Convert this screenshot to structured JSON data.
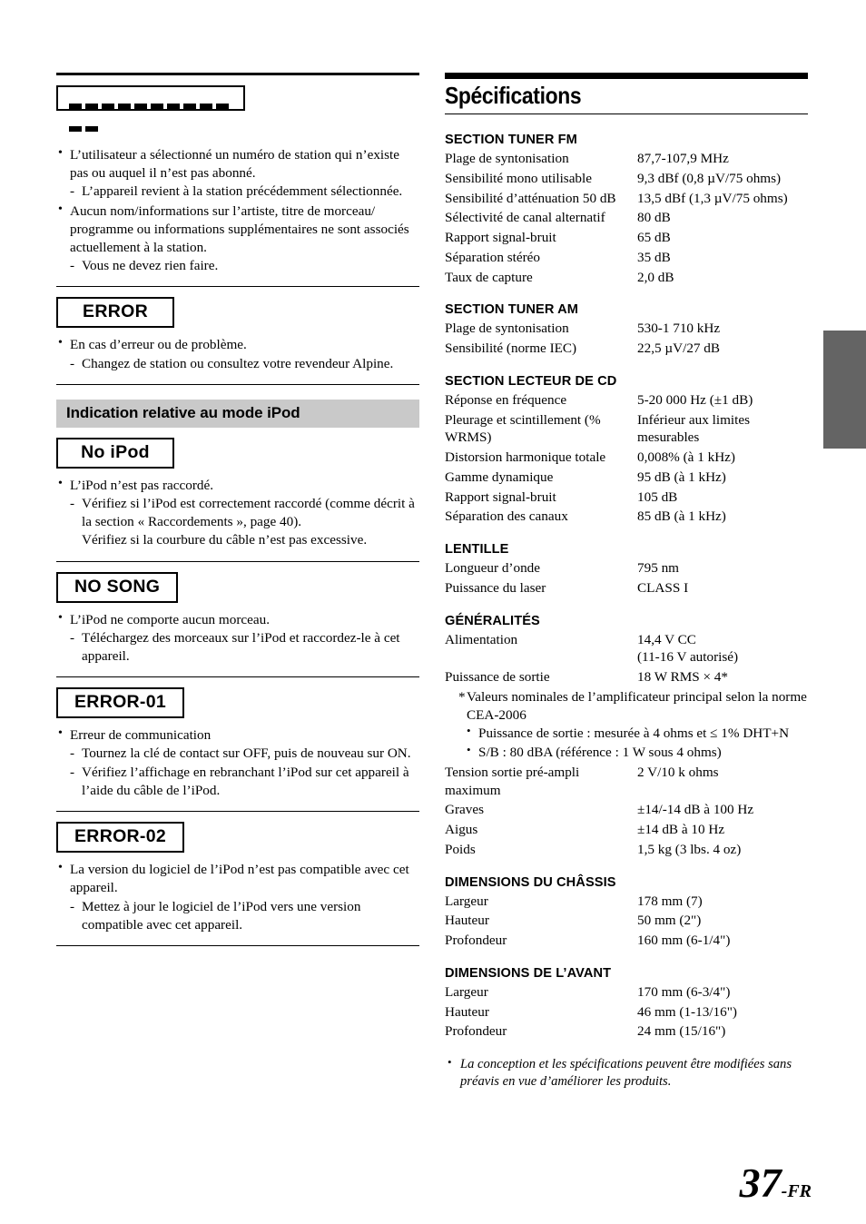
{
  "page": {
    "number": "37",
    "suffix": "-FR"
  },
  "left_column": {
    "blank_display": {
      "icon": "dashes-display",
      "dash_count": 12
    },
    "blank_display_items": [
      {
        "bullet": "L’utilisateur a sélectionné un numéro de station qui n’existe pas ou auquel il n’est pas abonné.",
        "sub": "L’appareil revient à la station précédemment sélectionnée."
      },
      {
        "bullet": "Aucun nom/informations sur l’artiste, titre de morceau/ programme ou informations supplémentaires ne sont associés actuellement à la station.",
        "sub": "Vous ne devez rien faire."
      }
    ],
    "error_box": {
      "label": "ERROR",
      "items": [
        {
          "bullet": "En cas d’erreur ou de problème.",
          "sub": "Changez de station ou consultez votre revendeur Alpine."
        }
      ]
    },
    "ipod_section": {
      "heading": "Indication relative au mode iPod"
    },
    "no_ipod_box": {
      "label": "No iPod",
      "items": [
        {
          "bullet": "L’iPod n’est pas raccordé.",
          "sub": "Vérifiez si l’iPod est correctement raccordé (comme décrit à la section « Raccordements », page 40).",
          "sub_cont": "Vérifiez si la courbure du câble n’est pas excessive."
        }
      ]
    },
    "no_song_box": {
      "label": "NO SONG",
      "items": [
        {
          "bullet": "L’iPod ne comporte aucun morceau.",
          "sub": "Téléchargez des morceaux sur l’iPod et raccordez-le à cet appareil."
        }
      ]
    },
    "error_01_box": {
      "label": "ERROR-01",
      "items": [
        {
          "bullet": "Erreur de communication",
          "sub": "Tournez la clé de contact sur OFF, puis de nouveau sur ON.",
          "sub2": "Vérifiez l’affichage en rebranchant l’iPod sur cet appareil à l’aide du câble de l’iPod."
        }
      ]
    },
    "error_02_box": {
      "label": "ERROR-02",
      "items": [
        {
          "bullet": "La version du logiciel de l’iPod n’est pas compatible avec cet appareil.",
          "sub": "Mettez à jour le logiciel de l’iPod vers une version compatible avec cet appareil."
        }
      ]
    }
  },
  "right_column": {
    "title": "Spécifications",
    "sections": [
      {
        "heading": "SECTION TUNER FM",
        "rows": [
          {
            "label": "Plage de syntonisation",
            "value": "87,7-107,9 MHz"
          },
          {
            "label": "Sensibilité mono utilisable",
            "value": "9,3 dBf (0,8 µV/75 ohms)"
          },
          {
            "label": "Sensibilité d’atténuation 50 dB",
            "value": "13,5 dBf (1,3 µV/75 ohms)"
          },
          {
            "label": "Sélectivité de canal alternatif",
            "value": "80 dB"
          },
          {
            "label": "Rapport signal-bruit",
            "value": "65 dB"
          },
          {
            "label": "Séparation stéréo",
            "value": "35 dB"
          },
          {
            "label": "Taux de capture",
            "value": "2,0 dB"
          }
        ]
      },
      {
        "heading": "SECTION TUNER AM",
        "rows": [
          {
            "label": "Plage de syntonisation",
            "value": "530-1 710 kHz"
          },
          {
            "label": "Sensibilité (norme IEC)",
            "value": "22,5 µV/27 dB"
          }
        ]
      },
      {
        "heading": "SECTION LECTEUR DE CD",
        "rows": [
          {
            "label": "Réponse en fréquence",
            "value": "5-20 000 Hz (±1 dB)"
          },
          {
            "label": "Pleurage et scintillement (% WRMS)",
            "value": "Inférieur aux limites mesurables"
          },
          {
            "label": "Distorsion harmonique totale",
            "value": "0,008% (à 1 kHz)"
          },
          {
            "label": "Gamme dynamique",
            "value": "95 dB (à 1 kHz)"
          },
          {
            "label": "Rapport signal-bruit",
            "value": "105 dB"
          },
          {
            "label": "Séparation des canaux",
            "value": "85 dB (à 1 kHz)"
          }
        ]
      },
      {
        "heading": "LENTILLE",
        "rows": [
          {
            "label": "Longueur d’onde",
            "value": "795 nm"
          },
          {
            "label": "Puissance du laser",
            "value": "CLASS I"
          }
        ]
      }
    ],
    "generalites": {
      "heading": "GÉNÉRALITÉS",
      "rows_top": [
        {
          "label": "Alimentation",
          "value": "14,4 V CC",
          "value2": "(11-16 V autorisé)"
        },
        {
          "label": "Puissance de sortie",
          "value": "18 W RMS × 4*"
        }
      ],
      "footnote": "Valeurs nominales de l’amplificateur principal selon la norme",
      "footnote_cont": "CEA-2006",
      "footnote_bullets": [
        "Puissance de sortie : mesurée à 4 ohms et ≤ 1% DHT+N",
        "S/B : 80 dBA (référence : 1 W sous 4 ohms)"
      ],
      "rows_bottom": [
        {
          "label": "Tension sortie pré-ampli maximum",
          "value": "2 V/10 k ohms"
        },
        {
          "label": "Graves",
          "value": "±14/-14 dB à 100 Hz"
        },
        {
          "label": "Aigus",
          "value": "±14 dB à 10 Hz"
        },
        {
          "label": "Poids",
          "value": "1,5 kg (3 lbs. 4 oz)"
        }
      ]
    },
    "dimensions_chassis": {
      "heading": "DIMENSIONS DU CHÂSSIS",
      "rows": [
        {
          "label": "Largeur",
          "value": "178 mm (7)"
        },
        {
          "label": "Hauteur",
          "value": "50 mm (2\")"
        },
        {
          "label": "Profondeur",
          "value": "160 mm (6-1/4\")"
        }
      ]
    },
    "dimensions_avant": {
      "heading": "DIMENSIONS DE L’AVANT",
      "rows": [
        {
          "label": "Largeur",
          "value": "170 mm (6-3/4\")"
        },
        {
          "label": "Hauteur",
          "value": "46 mm (1-13/16\")"
        },
        {
          "label": "Profondeur",
          "value": "24 mm (15/16\")"
        }
      ]
    },
    "end_note": "La conception et les spécifications peuvent être modifiées sans préavis en vue d’améliorer les produits."
  }
}
